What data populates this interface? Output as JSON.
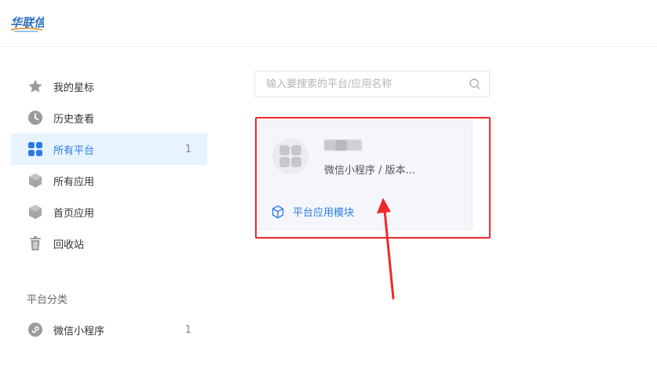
{
  "brand": {
    "logo_text": "华联信"
  },
  "sidebar": {
    "items": [
      {
        "label": "我的星标",
        "icon": "star-icon",
        "count": ""
      },
      {
        "label": "历史查看",
        "icon": "clock-icon",
        "count": ""
      },
      {
        "label": "所有平台",
        "icon": "grid-icon",
        "count": "1",
        "active": true
      },
      {
        "label": "所有应用",
        "icon": "cube-icon",
        "count": ""
      },
      {
        "label": "首页应用",
        "icon": "cube-icon",
        "count": ""
      },
      {
        "label": "回收站",
        "icon": "trash-icon",
        "count": ""
      }
    ],
    "section_title": "平台分类",
    "categories": [
      {
        "label": "微信小程序",
        "icon": "miniprogram-icon",
        "count": "1"
      }
    ]
  },
  "search": {
    "placeholder": "输入要搜索的平台/应用名称",
    "value": ""
  },
  "card": {
    "subtitle": "微信小程序 / 版本...",
    "module_label": "平台应用模块"
  },
  "colors": {
    "accent": "#2c7be5",
    "active_bg": "#e7f3ff",
    "highlight": "#ec2a2a",
    "icon_gray": "#9a9aa0"
  }
}
